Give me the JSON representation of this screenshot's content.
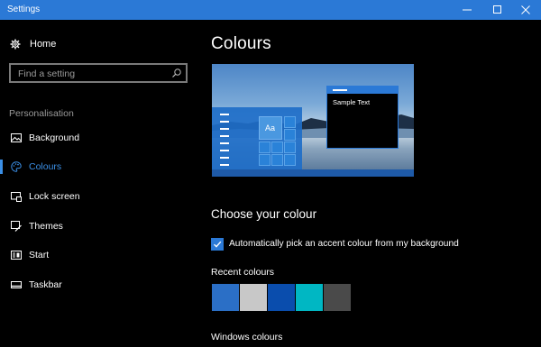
{
  "window": {
    "title": "Settings",
    "controls": [
      "minimize-icon",
      "maximize-icon",
      "close-icon"
    ]
  },
  "sidebar": {
    "home": {
      "label": "Home",
      "icon": "gear-icon"
    },
    "search": {
      "placeholder": "Find a setting",
      "icon": "search-icon"
    },
    "section_label": "Personalisation",
    "items": [
      {
        "label": "Background",
        "icon": "picture-icon",
        "active": false
      },
      {
        "label": "Colours",
        "icon": "palette-icon",
        "active": true
      },
      {
        "label": "Lock screen",
        "icon": "lock-screen-icon",
        "active": false
      },
      {
        "label": "Themes",
        "icon": "brush-icon",
        "active": false
      },
      {
        "label": "Start",
        "icon": "start-icon",
        "active": false
      },
      {
        "label": "Taskbar",
        "icon": "taskbar-icon",
        "active": false
      }
    ]
  },
  "main": {
    "title": "Colours",
    "preview": {
      "tile_text": "Aa",
      "window_text": "Sample Text"
    },
    "choose_title": "Choose your colour",
    "auto_accent": {
      "label": "Automatically pick an accent colour from my background",
      "checked": true
    },
    "recent_label": "Recent colours",
    "recent_colours": [
      "#2b6fc6",
      "#c8c8c8",
      "#0a4dad",
      "#00b7c3",
      "#4a4a4a"
    ],
    "windows_colours_label": "Windows colours"
  },
  "colors": {
    "accent": "#2b79d6",
    "active_text": "#3b8fe6",
    "background": "#000000"
  }
}
